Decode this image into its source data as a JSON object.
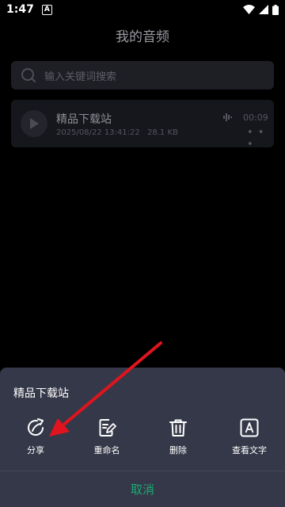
{
  "status_bar": {
    "time": "1:47",
    "notify_icon": "A"
  },
  "page": {
    "title": "我的音频",
    "search": {
      "placeholder": "输入关键词搜索"
    },
    "file": {
      "name": "精品下载站",
      "date": "2025/08/22 13:41:22",
      "size": "28.1 KB",
      "duration": "00:09"
    }
  },
  "sheet": {
    "title": "精品下载站",
    "actions": [
      {
        "label": "分享",
        "icon": "share-icon"
      },
      {
        "label": "重命名",
        "icon": "edit-note-icon"
      },
      {
        "label": "删除",
        "icon": "trash-icon"
      },
      {
        "label": "查看文字",
        "icon": "text-icon"
      }
    ],
    "cancel_label": "取消"
  },
  "colors": {
    "background": "#000000",
    "sheet_bg": "#353848",
    "accent_green": "#1aab74",
    "annotation_red": "#e0141e"
  }
}
